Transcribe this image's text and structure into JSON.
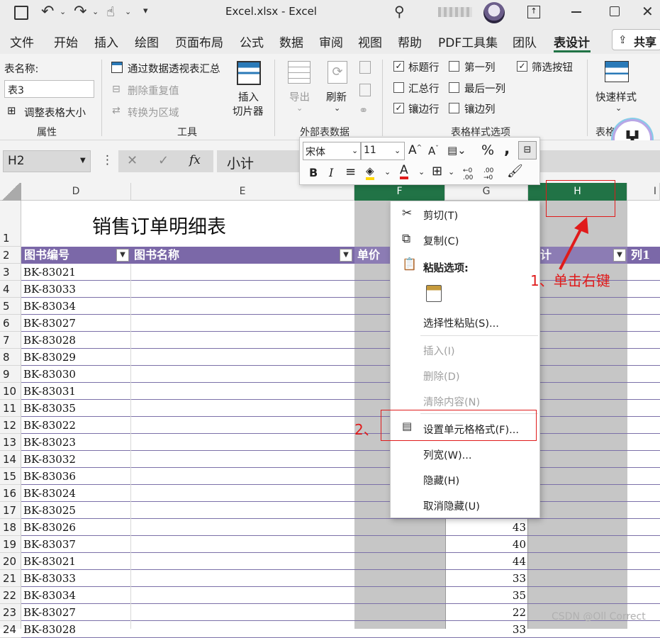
{
  "titlebar": {
    "filename": "Excel.xlsx",
    "separator": "-",
    "app": "Excel"
  },
  "tabs": [
    "文件",
    "开始",
    "插入",
    "绘图",
    "页面布局",
    "公式",
    "数据",
    "审阅",
    "视图",
    "帮助",
    "PDF工具集",
    "团队",
    "表设计"
  ],
  "share_label": "共享",
  "ribbon": {
    "table_name_label": "表名称:",
    "table_name_value": "表3",
    "resize_label": "调整表格大小",
    "group_props": "属性",
    "pivot_label": "通过数据透视表汇总",
    "remove_dup_label": "删除重复值",
    "convert_label": "转换为区域",
    "slicer_label_1": "插入",
    "slicer_label_2": "切片器",
    "group_tools": "工具",
    "export_label": "导出",
    "refresh_label": "刷新",
    "group_external": "外部表数据",
    "opt_header_row": "标题行",
    "opt_total_row": "汇总行",
    "opt_banded_rows": "镶边行",
    "opt_first_col": "第一列",
    "opt_last_col": "最后一列",
    "opt_banded_cols": "镶边列",
    "opt_filter_btn": "筛选按钮",
    "group_style_opts": "表格样式选项",
    "quick_styles": "快速样式",
    "group_styles": "表格样式"
  },
  "formula": {
    "namebox": "H2",
    "fx": "fx",
    "value": "小计"
  },
  "columns": [
    "D",
    "E",
    "F",
    "G",
    "H",
    "I"
  ],
  "sheet": {
    "title": "销售订单明细表",
    "headers": {
      "d": "图书编号",
      "e": "图书名称",
      "f": "单价",
      "h": "计",
      "i": "列1"
    },
    "rows": [
      "1",
      "2",
      "3",
      "4",
      "5",
      "6",
      "7",
      "8",
      "9",
      "10",
      "11",
      "12",
      "13",
      "14",
      "15",
      "16",
      "17",
      "18",
      "19",
      "20",
      "21",
      "22",
      "23",
      "24"
    ],
    "codes": [
      "BK-83021",
      "BK-83033",
      "BK-83034",
      "BK-83027",
      "BK-83028",
      "BK-83029",
      "BK-83030",
      "BK-83031",
      "BK-83035",
      "BK-83022",
      "BK-83023",
      "BK-83032",
      "BK-83036",
      "BK-83024",
      "BK-83025",
      "BK-83026",
      "BK-83037",
      "BK-83021",
      "BK-83033",
      "BK-83034",
      "BK-83027",
      "BK-83028"
    ],
    "g_values": [
      "43",
      "40",
      "44",
      "33",
      "35",
      "22",
      "33"
    ]
  },
  "mini_toolbar": {
    "font": "宋体",
    "size": "11",
    "percent": "%",
    "comma": ",",
    "bold": "B",
    "italic": "I",
    "font_color_glyph": "A",
    "dec_more": "←0 .00",
    "dec_less": ".00 →0"
  },
  "context_menu": {
    "cut": "剪切(T)",
    "copy": "复制(C)",
    "paste_options": "粘贴选项:",
    "paste_special": "选择性粘贴(S)...",
    "insert": "插入(I)",
    "delete": "删除(D)",
    "clear": "清除内容(N)",
    "format_cells": "设置单元格格式(F)...",
    "col_width": "列宽(W)...",
    "hide": "隐藏(H)",
    "unhide": "取消隐藏(U)"
  },
  "annotations": {
    "step1": "1、单击右键",
    "step2": "2、"
  },
  "watermark": "CSDN @Oll Correct",
  "colors": {
    "accent": "#217346",
    "table_header": "#7b68a8",
    "annotation": "#e01b1b"
  }
}
